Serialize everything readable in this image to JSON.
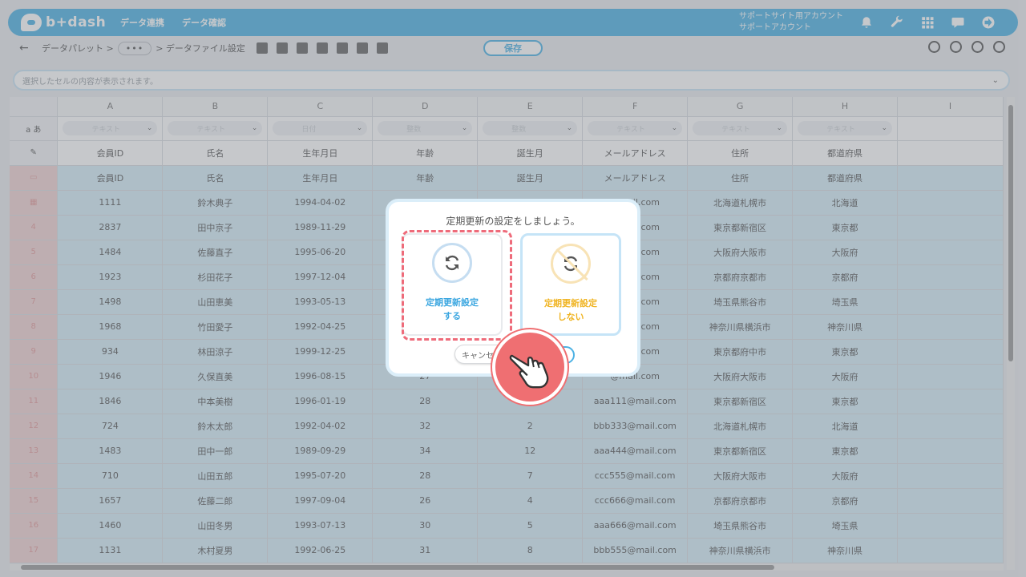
{
  "header": {
    "logo_text": "b+dash",
    "nav": [
      "データ連携",
      "データ確認"
    ],
    "account_line1": "サポートサイト用アカウント",
    "account_line2": "サポートアカウント"
  },
  "toolbar": {
    "back_icon": "←",
    "crumb_palette": "データパレット >",
    "crumb_dots": "•••",
    "crumb_file": "> データファイル設定",
    "save_label": "保存"
  },
  "cellbar": {
    "placeholder": "選択したセルの内容が表示されます。"
  },
  "grid": {
    "type_row_label": "a あ",
    "columns": [
      "A",
      "B",
      "C",
      "D",
      "E",
      "F",
      "G",
      "H",
      "I"
    ],
    "type_values": [
      "テキスト",
      "テキスト",
      "日付",
      "整数",
      "整数",
      "テキスト",
      "テキスト",
      "テキスト"
    ],
    "header_names": [
      "会員ID",
      "氏名",
      "生年月日",
      "年齢",
      "誕生月",
      "メールアドレス",
      "住所",
      "都道府県"
    ],
    "rows": [
      {
        "num": "",
        "cells": [
          "1111",
          "鈴木典子",
          "1994-04-02",
          "",
          "",
          "@mail.com",
          "北海道札幌市",
          "北海道"
        ]
      },
      {
        "num": "4",
        "cells": [
          "2837",
          "田中京子",
          "1989-11-29",
          "",
          "",
          "@mail.com",
          "東京都新宿区",
          "東京都"
        ]
      },
      {
        "num": "5",
        "cells": [
          "1484",
          "佐藤直子",
          "1995-06-20",
          "",
          "",
          "@mail.com",
          "大阪府大阪市",
          "大阪府"
        ]
      },
      {
        "num": "6",
        "cells": [
          "1923",
          "杉田花子",
          "1997-12-04",
          "",
          "",
          "@mail.com",
          "京都府京都市",
          "京都府"
        ]
      },
      {
        "num": "7",
        "cells": [
          "1498",
          "山田恵美",
          "1993-05-13",
          "",
          "",
          "@mail.com",
          "埼玉県熊谷市",
          "埼玉県"
        ]
      },
      {
        "num": "8",
        "cells": [
          "1968",
          "竹田愛子",
          "1992-04-25",
          "",
          "",
          "@mail.com",
          "神奈川県横浜市",
          "神奈川県"
        ]
      },
      {
        "num": "9",
        "cells": [
          "934",
          "林田涼子",
          "1999-12-25",
          "",
          "",
          "@mail.com",
          "東京都府中市",
          "東京都"
        ]
      },
      {
        "num": "10",
        "cells": [
          "1946",
          "久保直美",
          "1996-08-15",
          "27",
          "",
          "@mail.com",
          "大阪府大阪市",
          "大阪府"
        ]
      },
      {
        "num": "11",
        "cells": [
          "1846",
          "中本美樹",
          "1996-01-19",
          "28",
          "",
          "aaa111@mail.com",
          "東京都新宿区",
          "東京都"
        ]
      },
      {
        "num": "12",
        "cells": [
          "724",
          "鈴木太郎",
          "1992-04-02",
          "32",
          "2",
          "bbb333@mail.com",
          "北海道札幌市",
          "北海道"
        ]
      },
      {
        "num": "13",
        "cells": [
          "1483",
          "田中一郎",
          "1989-09-29",
          "34",
          "12",
          "aaa444@mail.com",
          "東京都新宿区",
          "東京都"
        ]
      },
      {
        "num": "14",
        "cells": [
          "710",
          "山田五郎",
          "1995-07-20",
          "28",
          "7",
          "ccc555@mail.com",
          "大阪府大阪市",
          "大阪府"
        ]
      },
      {
        "num": "15",
        "cells": [
          "1657",
          "佐藤二郎",
          "1997-09-04",
          "26",
          "4",
          "ccc666@mail.com",
          "京都府京都市",
          "京都府"
        ]
      },
      {
        "num": "16",
        "cells": [
          "1460",
          "山田冬男",
          "1993-07-13",
          "30",
          "5",
          "aaa666@mail.com",
          "埼玉県熊谷市",
          "埼玉県"
        ]
      },
      {
        "num": "17",
        "cells": [
          "1131",
          "木村夏男",
          "1992-06-25",
          "31",
          "8",
          "bbb555@mail.com",
          "神奈川県横浜市",
          "神奈川県"
        ]
      }
    ]
  },
  "modal": {
    "title": "定期更新の設定をしましょう。",
    "option_yes": "定期更新設定\nする",
    "option_no": "定期更新設定\nしない",
    "cancel_label": "キャンセル"
  },
  "colors": {
    "brand": "#4db2e4",
    "highlight": "#ee6b7a",
    "warning": "#f0b422"
  }
}
